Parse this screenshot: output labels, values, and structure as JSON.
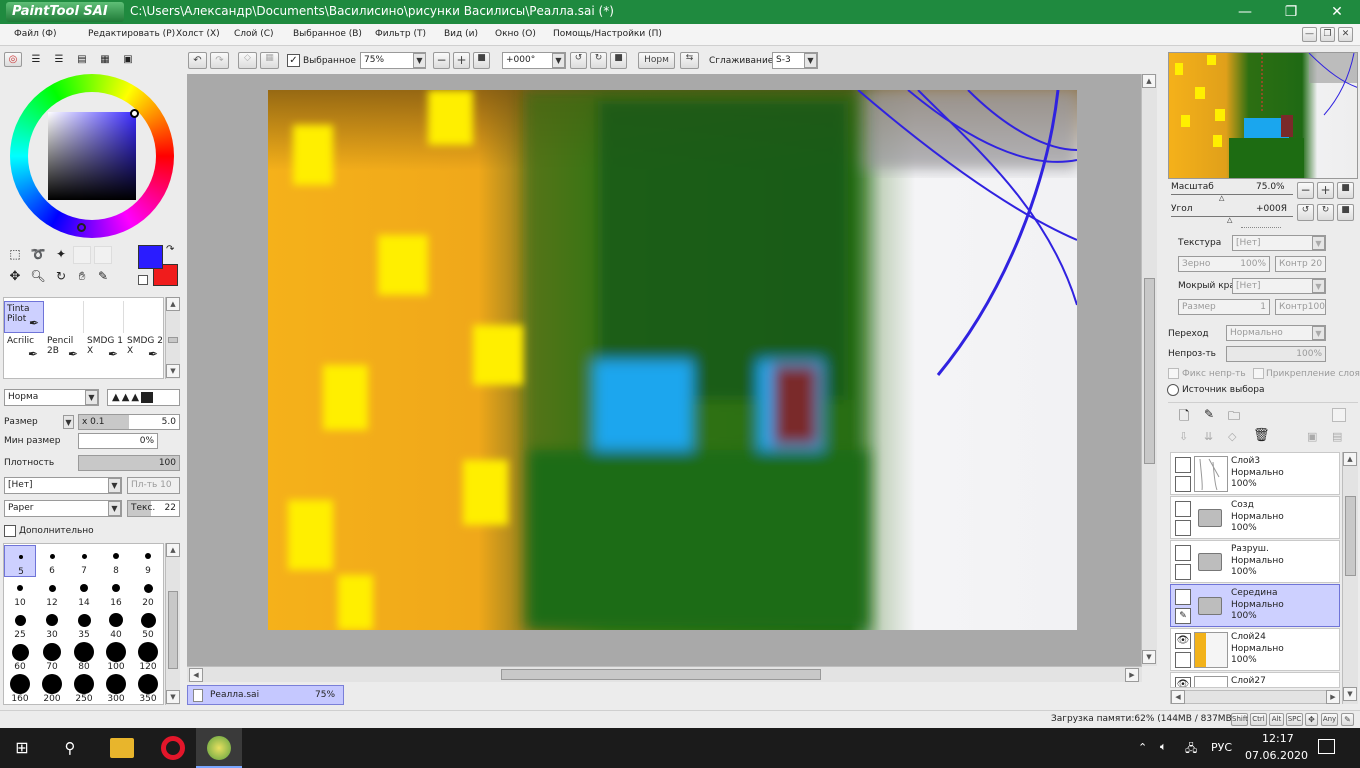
{
  "app": {
    "logo_text": "PaintTool SAI",
    "title": "C:\\Users\\Александр\\Documents\\Василисино\\рисунки Василисы\\Реалла.sai (*)"
  },
  "menu": [
    "Файл (Ф)",
    "Редактировать (Р)",
    "Холст (Х)",
    "Слой (С)",
    "Выбранное (В)",
    "Фильтр (Т)",
    "Вид (и)",
    "Окно (О)",
    "Помощь/Настройки (П)"
  ],
  "toolbar": {
    "selection_label": "Выбранное",
    "zoom": "75%",
    "angle": "+000°",
    "flip_label": "Норм",
    "smoothing_label": "Сглаживание",
    "smoothing_value": "S-3"
  },
  "brushes": [
    {
      "name": "Tinta\nPilot",
      "selected": true
    },
    {
      "name": "Acrilic",
      "selected": false
    },
    {
      "name": "Pencil\n2B",
      "selected": false
    },
    {
      "name": "SMDG 1\nX",
      "selected": false
    },
    {
      "name": "SMDG 2\nX",
      "selected": false
    }
  ],
  "brush_settings": {
    "mode": "Норма",
    "size_label": "Размер",
    "size_mult": "x 0.1",
    "size_value": "5.0",
    "min_size_label": "Мин размер",
    "min_size_value": "0%",
    "density_label": "Плотность",
    "density_value": "100",
    "shape": "[Нет]",
    "shape_strength": "Пл-ть 10",
    "texture": "Paper",
    "texture_label": "Текс.",
    "texture_value": "22",
    "extra_label": "Дополнительно"
  },
  "brush_sizes": [
    "5",
    "6",
    "7",
    "8",
    "9",
    "10",
    "12",
    "14",
    "16",
    "20",
    "25",
    "30",
    "35",
    "40",
    "50",
    "60",
    "70",
    "80",
    "100",
    "120",
    "160",
    "200",
    "250",
    "300",
    "350"
  ],
  "navigator": {
    "zoom_label": "Масштаб",
    "zoom_value": "75.0%",
    "angle_label": "Угол",
    "angle_value": "+000Я"
  },
  "layer_props": {
    "texture_label": "Текстура",
    "texture_value": "[Нет]",
    "grain_label": "Зерно",
    "grain_value": "100%",
    "contrast_label": "Контр 20",
    "wet_edge_label": "Мокрый край",
    "wet_edge_value": "[Нет]",
    "size_label": "Размер",
    "size_value": "1",
    "contrast2_label": "Контр100",
    "blend_label": "Переход",
    "blend_value": "Нормально",
    "opacity_label": "Непроз-ть",
    "opacity_value": "100%",
    "preserve_opacity": "Фикс непр-ть",
    "clipping": "Прикрепление слоя",
    "selection_source": "Источник выбора"
  },
  "layers": [
    {
      "name": "Слой3",
      "mode": "Нормально",
      "opacity": "100%",
      "visible": false,
      "selected": false,
      "kind": "layer"
    },
    {
      "name": "Созд",
      "mode": "Нормально",
      "opacity": "100%",
      "visible": false,
      "selected": false,
      "kind": "folder"
    },
    {
      "name": "Разруш.",
      "mode": "Нормально",
      "opacity": "100%",
      "visible": false,
      "selected": false,
      "kind": "folder"
    },
    {
      "name": "Середина",
      "mode": "Нормально",
      "opacity": "100%",
      "visible": false,
      "selected": true,
      "kind": "folder"
    },
    {
      "name": "Слой24",
      "mode": "Нормально",
      "opacity": "100%",
      "visible": true,
      "selected": false,
      "kind": "layer"
    },
    {
      "name": "Слой27",
      "mode": "",
      "opacity": "",
      "visible": true,
      "selected": false,
      "kind": "layer"
    }
  ],
  "document_tab": {
    "name": "Реалла.sai",
    "zoom": "75%"
  },
  "status": {
    "memory": "Загрузка памяти:62% (144MB / 837MB)",
    "keys": [
      "Shift",
      "Ctrl",
      "Alt",
      "SPC",
      "Any"
    ]
  },
  "taskbar": {
    "lang": "РУС",
    "time": "12:17",
    "date": "07.06.2020"
  },
  "colors": {
    "title_green": "#1f8a3f",
    "primary": "#2a1cff",
    "secondary": "#f01c1c",
    "selected_layer": "#cdd0ff"
  }
}
